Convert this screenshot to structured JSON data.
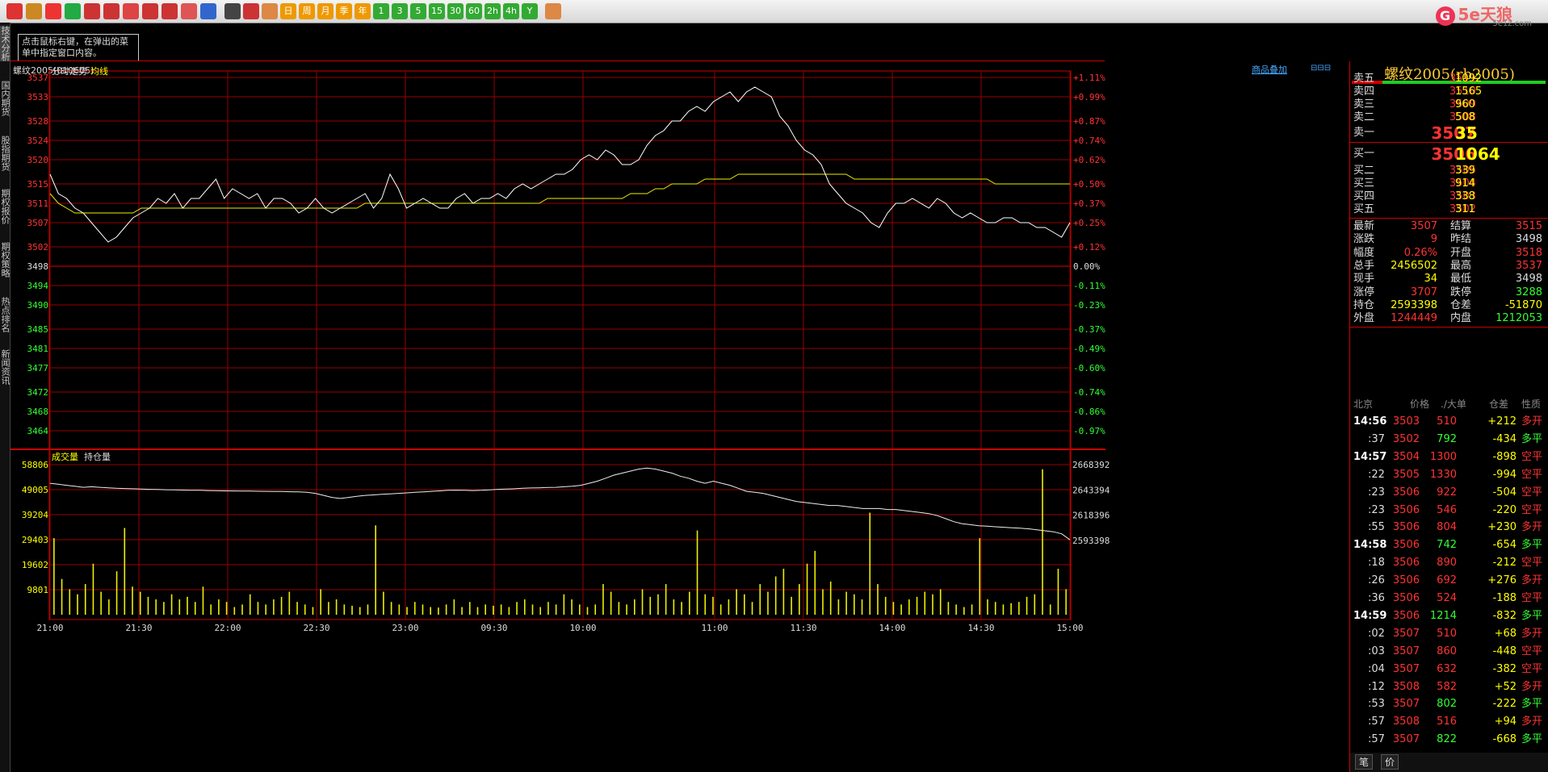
{
  "toolbar": {
    "buttons": [
      "home-icon",
      "notebook-icon",
      "calendar-icon",
      "refresh-icon",
      "zoom-in-icon",
      "zoom-out-icon",
      "window-icon",
      "pen-icon",
      "bookmark-icon",
      "filter-icon",
      "magic-icon",
      "table-icon",
      "intraday-chart-icon",
      "kline-icon",
      "day-icon",
      "week-icon",
      "month-icon",
      "season-icon",
      "year-icon",
      "1min-icon",
      "3min-icon",
      "5min-icon",
      "15min-icon",
      "30min-icon",
      "60min-icon",
      "2hour-icon",
      "4hour-icon",
      "custom-icon",
      "calculator-icon"
    ],
    "button_text": [
      "",
      "",
      "",
      "",
      "",
      "",
      "",
      "",
      "",
      "",
      "",
      "",
      "",
      "",
      "日",
      "周",
      "月",
      "季",
      "年",
      "1",
      "3",
      "5",
      "15",
      "30",
      "60",
      "2h",
      "4h",
      "Y",
      ""
    ],
    "logo_text": "5e天狼",
    "logo_sub": "5e1z.com"
  },
  "tooltip": "点击鼠标右键，在弹出的菜单中指定窗口内容。",
  "left_tabs": [
    "技术分析",
    "国内期货",
    "股指期货",
    "期权报价",
    "期权策略",
    "热点排名",
    "新闻资讯"
  ],
  "chart": {
    "title": "螺纹2005(010605)",
    "overlay_link": "商品叠加",
    "price_label": "分时走势",
    "avg_label": "均线",
    "vol_label": "成交量",
    "oi_label": "持仓量"
  },
  "chart_data": {
    "type": "line",
    "prev_settle": 3498,
    "price_axis": [
      3537,
      3533,
      3528,
      3524,
      3520,
      3515,
      3511,
      3507,
      3502,
      3498,
      3494,
      3490,
      3485,
      3481,
      3477,
      3472,
      3468,
      3464
    ],
    "pct_axis": [
      "+1.11%",
      "+0.99%",
      "+0.87%",
      "+0.74%",
      "+0.62%",
      "+0.50%",
      "+0.37%",
      "+0.25%",
      "+0.12%",
      "0.00%",
      "-0.11%",
      "-0.23%",
      "-0.37%",
      "-0.49%",
      "-0.60%",
      "-0.74%",
      "-0.86%",
      "-0.97%"
    ],
    "vol_axis": [
      58806,
      49005,
      39204,
      29403,
      19602,
      9801
    ],
    "oi_axis": [
      2668392,
      2643394,
      2618396,
      2593398
    ],
    "time_axis": [
      "21:00",
      "21:30",
      "22:00",
      "22:30",
      "23:00",
      "09:30",
      "10:00",
      "11:00",
      "11:30",
      "14:00",
      "14:30",
      "15:00"
    ],
    "price": [
      3517,
      3513,
      3512,
      3510,
      3509,
      3507,
      3505,
      3503,
      3504,
      3506,
      3508,
      3509,
      3510,
      3512,
      3511,
      3513,
      3510,
      3512,
      3512,
      3514,
      3516,
      3512,
      3514,
      3513,
      3512,
      3513,
      3510,
      3512,
      3512,
      3511,
      3509,
      3510,
      3512,
      3510,
      3509,
      3510,
      3511,
      3512,
      3513,
      3510,
      3512,
      3517,
      3514,
      3510,
      3511,
      3512,
      3511,
      3510,
      3510,
      3512,
      3513,
      3511,
      3512,
      3512,
      3513,
      3512,
      3514,
      3515,
      3514,
      3515,
      3516,
      3517,
      3517,
      3518,
      3520,
      3521,
      3520,
      3522,
      3521,
      3519,
      3519,
      3520,
      3523,
      3525,
      3526,
      3528,
      3528,
      3530,
      3531,
      3530,
      3532,
      3533,
      3534,
      3532,
      3534,
      3535,
      3534,
      3533,
      3529,
      3527,
      3524,
      3522,
      3521,
      3519,
      3515,
      3513,
      3511,
      3510,
      3509,
      3507,
      3506,
      3509,
      3511,
      3511,
      3512,
      3511,
      3510,
      3512,
      3511,
      3509,
      3508,
      3509,
      3508,
      3507,
      3507,
      3508,
      3508,
      3507,
      3507,
      3506,
      3506,
      3505,
      3504,
      3507
    ],
    "avg": [
      3513,
      3511,
      3510,
      3509,
      3509,
      3509,
      3509,
      3509,
      3509,
      3509,
      3509,
      3510,
      3510,
      3510,
      3510,
      3510,
      3510,
      3510,
      3510,
      3510,
      3510,
      3510,
      3510,
      3510,
      3510,
      3510,
      3510,
      3510,
      3510,
      3510,
      3510,
      3510,
      3510,
      3510,
      3510,
      3510,
      3510,
      3510,
      3511,
      3511,
      3511,
      3511,
      3511,
      3511,
      3511,
      3511,
      3511,
      3511,
      3511,
      3511,
      3511,
      3511,
      3511,
      3511,
      3511,
      3511,
      3511,
      3511,
      3511,
      3511,
      3512,
      3512,
      3512,
      3512,
      3512,
      3512,
      3512,
      3512,
      3512,
      3512,
      3513,
      3513,
      3513,
      3514,
      3514,
      3515,
      3515,
      3515,
      3515,
      3516,
      3516,
      3516,
      3516,
      3517,
      3517,
      3517,
      3517,
      3517,
      3517,
      3517,
      3517,
      3517,
      3517,
      3517,
      3517,
      3517,
      3517,
      3516,
      3516,
      3516,
      3516,
      3516,
      3516,
      3516,
      3516,
      3516,
      3516,
      3516,
      3516,
      3516,
      3516,
      3516,
      3516,
      3516,
      3515,
      3515,
      3515,
      3515,
      3515,
      3515,
      3515,
      3515,
      3515,
      3515
    ],
    "oi": [
      2650000,
      2649000,
      2648000,
      2647000,
      2646000,
      2646500,
      2646000,
      2645500,
      2645000,
      2644800,
      2644500,
      2644200,
      2644000,
      2643800,
      2643600,
      2643500,
      2643300,
      2643100,
      2643000,
      2642800,
      2642600,
      2642500,
      2642400,
      2642300,
      2642200,
      2642100,
      2642000,
      2641900,
      2641800,
      2641600,
      2641400,
      2641000,
      2640000,
      2638000,
      2636000,
      2635000,
      2636000,
      2637000,
      2638000,
      2638500,
      2639000,
      2639500,
      2640000,
      2640500,
      2641000,
      2641500,
      2642000,
      2642500,
      2643000,
      2643200,
      2643000,
      2642800,
      2643000,
      2643500,
      2644000,
      2644200,
      2644500,
      2645000,
      2645300,
      2645500,
      2645800,
      2646000,
      2646500,
      2647000,
      2648000,
      2650000,
      2652000,
      2655000,
      2658000,
      2660000,
      2662000,
      2664000,
      2665000,
      2664000,
      2662000,
      2660000,
      2657000,
      2655000,
      2652000,
      2650000,
      2652000,
      2650000,
      2648000,
      2645000,
      2642000,
      2641000,
      2640000,
      2638000,
      2636000,
      2634000,
      2632000,
      2631000,
      2630000,
      2629000,
      2628000,
      2628000,
      2627000,
      2626000,
      2625000,
      2625000,
      2625000,
      2624000,
      2624000,
      2623000,
      2622000,
      2621000,
      2620000,
      2618000,
      2615000,
      2612000,
      2610000,
      2609000,
      2608000,
      2607500,
      2607000,
      2606500,
      2606000,
      2605500,
      2605000,
      2604000,
      2603000,
      2602000,
      2600000,
      2594000
    ],
    "volume": [
      30000,
      14000,
      10000,
      8000,
      12000,
      20000,
      9000,
      6000,
      17000,
      34000,
      11000,
      9000,
      7000,
      6000,
      5000,
      8000,
      6000,
      7000,
      5000,
      11000,
      4000,
      6000,
      5000,
      3000,
      4000,
      8000,
      5000,
      4000,
      6000,
      7000,
      9000,
      5000,
      4000,
      3000,
      10000,
      5000,
      6000,
      4000,
      3500,
      3000,
      4000,
      35000,
      9000,
      5000,
      4000,
      3000,
      5000,
      4000,
      3000,
      2800,
      4000,
      6000,
      3000,
      5000,
      3000,
      4000,
      3500,
      4000,
      3000,
      5000,
      6000,
      4000,
      3000,
      5000,
      4000,
      8000,
      6000,
      4000,
      3000,
      4000,
      12000,
      9000,
      5000,
      4000,
      6000,
      10000,
      7000,
      8000,
      12000,
      6000,
      5000,
      9000,
      33000,
      8000,
      7000,
      4000,
      6000,
      10000,
      8000,
      5000,
      12000,
      9000,
      15000,
      18000,
      7000,
      12000,
      20000,
      25000,
      10000,
      13000,
      6000,
      9000,
      8000,
      6000,
      40000,
      12000,
      7000,
      5000,
      4000,
      6000,
      7000,
      9000,
      8000,
      10000,
      5000,
      4000,
      3000,
      4000,
      30000,
      6000,
      5000,
      4000,
      4500,
      5000,
      7000,
      8000,
      57000,
      4000,
      18000,
      10000
    ]
  },
  "quote": {
    "title": "螺纹2005(rb2005)",
    "asks": [
      {
        "label": "卖五",
        "price": "3511",
        "vol": "1092"
      },
      {
        "label": "卖四",
        "price": "3510",
        "vol": "1565"
      },
      {
        "label": "卖三",
        "price": "3509",
        "vol": "960"
      },
      {
        "label": "卖二",
        "price": "3508",
        "vol": "508"
      },
      {
        "label": "卖一",
        "price": "3507",
        "vol": "35"
      }
    ],
    "bids": [
      {
        "label": "买一",
        "price": "3506",
        "vol": "1064"
      },
      {
        "label": "买二",
        "price": "3505",
        "vol": "339"
      },
      {
        "label": "买三",
        "price": "3504",
        "vol": "914"
      },
      {
        "label": "买四",
        "price": "3503",
        "vol": "338"
      },
      {
        "label": "买五",
        "price": "3502",
        "vol": "311"
      }
    ],
    "stats": [
      {
        "l1": "最新",
        "v1": "3507",
        "c1": "#f33",
        "l2": "结算",
        "v2": "3515",
        "c2": "#f33"
      },
      {
        "l1": "涨跌",
        "v1": "9",
        "c1": "#f33",
        "l2": "昨结",
        "v2": "3498",
        "c2": "#ddd"
      },
      {
        "l1": "幅度",
        "v1": "0.26%",
        "c1": "#f33",
        "l2": "开盘",
        "v2": "3518",
        "c2": "#f33"
      },
      {
        "l1": "总手",
        "v1": "2456502",
        "c1": "#ff0",
        "l2": "最高",
        "v2": "3537",
        "c2": "#f33"
      },
      {
        "l1": "现手",
        "v1": "34",
        "c1": "#ff0",
        "l2": "最低",
        "v2": "3498",
        "c2": "#ddd"
      },
      {
        "l1": "涨停",
        "v1": "3707",
        "c1": "#f33",
        "l2": "跌停",
        "v2": "3288",
        "c2": "#3f3"
      },
      {
        "l1": "持仓",
        "v1": "2593398",
        "c1": "#ff0",
        "l2": "仓差",
        "v2": "-51870",
        "c2": "#ff0"
      },
      {
        "l1": "外盘",
        "v1": "1244449",
        "c1": "#f33",
        "l2": "内盘",
        "v2": "1212053",
        "c2": "#3f3"
      }
    ],
    "ticks_header": [
      "北京",
      "价格",
      "./大单",
      "仓差",
      "性质"
    ],
    "ticks": [
      {
        "t": "14:56",
        "p": "3503",
        "v": "510",
        "d": "+212",
        "n": "多开",
        "vc": "#f33",
        "nc": "#f33"
      },
      {
        "t": ":37",
        "p": "3502",
        "v": "792",
        "d": "-434",
        "n": "多平",
        "vc": "#3f3",
        "nc": "#3f3"
      },
      {
        "t": "14:57",
        "p": "3504",
        "v": "1300",
        "d": "-898",
        "n": "空平",
        "vc": "#f33",
        "nc": "#f33"
      },
      {
        "t": ":22",
        "p": "3505",
        "v": "1330",
        "d": "-994",
        "n": "空平",
        "vc": "#f33",
        "nc": "#f33"
      },
      {
        "t": ":23",
        "p": "3506",
        "v": "922",
        "d": "-504",
        "n": "空平",
        "vc": "#f33",
        "nc": "#f33"
      },
      {
        "t": ":23",
        "p": "3506",
        "v": "546",
        "d": "-220",
        "n": "空平",
        "vc": "#f33",
        "nc": "#f33"
      },
      {
        "t": ":55",
        "p": "3506",
        "v": "804",
        "d": "+230",
        "n": "多开",
        "vc": "#f33",
        "nc": "#f33"
      },
      {
        "t": "14:58",
        "p": "3506",
        "v": "742",
        "d": "-654",
        "n": "多平",
        "vc": "#3f3",
        "nc": "#3f3"
      },
      {
        "t": ":18",
        "p": "3506",
        "v": "890",
        "d": "-212",
        "n": "空平",
        "vc": "#f33",
        "nc": "#f33"
      },
      {
        "t": ":26",
        "p": "3506",
        "v": "692",
        "d": "+276",
        "n": "多开",
        "vc": "#f33",
        "nc": "#f33"
      },
      {
        "t": ":36",
        "p": "3506",
        "v": "524",
        "d": "-188",
        "n": "空平",
        "vc": "#f33",
        "nc": "#f33"
      },
      {
        "t": "14:59",
        "p": "3506",
        "v": "1214",
        "d": "-832",
        "n": "多平",
        "vc": "#3f3",
        "nc": "#3f3"
      },
      {
        "t": ":02",
        "p": "3507",
        "v": "510",
        "d": "+68",
        "n": "多开",
        "vc": "#f33",
        "nc": "#f33"
      },
      {
        "t": ":03",
        "p": "3507",
        "v": "860",
        "d": "-448",
        "n": "空平",
        "vc": "#f33",
        "nc": "#f33"
      },
      {
        "t": ":04",
        "p": "3507",
        "v": "632",
        "d": "-382",
        "n": "空平",
        "vc": "#f33",
        "nc": "#f33"
      },
      {
        "t": ":12",
        "p": "3508",
        "v": "582",
        "d": "+52",
        "n": "多开",
        "vc": "#f33",
        "nc": "#f33"
      },
      {
        "t": ":53",
        "p": "3507",
        "v": "802",
        "d": "-222",
        "n": "多平",
        "vc": "#3f3",
        "nc": "#3f3"
      },
      {
        "t": ":57",
        "p": "3508",
        "v": "516",
        "d": "+94",
        "n": "多开",
        "vc": "#f33",
        "nc": "#f33"
      },
      {
        "t": ":57",
        "p": "3507",
        "v": "822",
        "d": "-668",
        "n": "多平",
        "vc": "#3f3",
        "nc": "#3f3"
      }
    ],
    "bottom_tabs": [
      "笔",
      "价"
    ]
  }
}
